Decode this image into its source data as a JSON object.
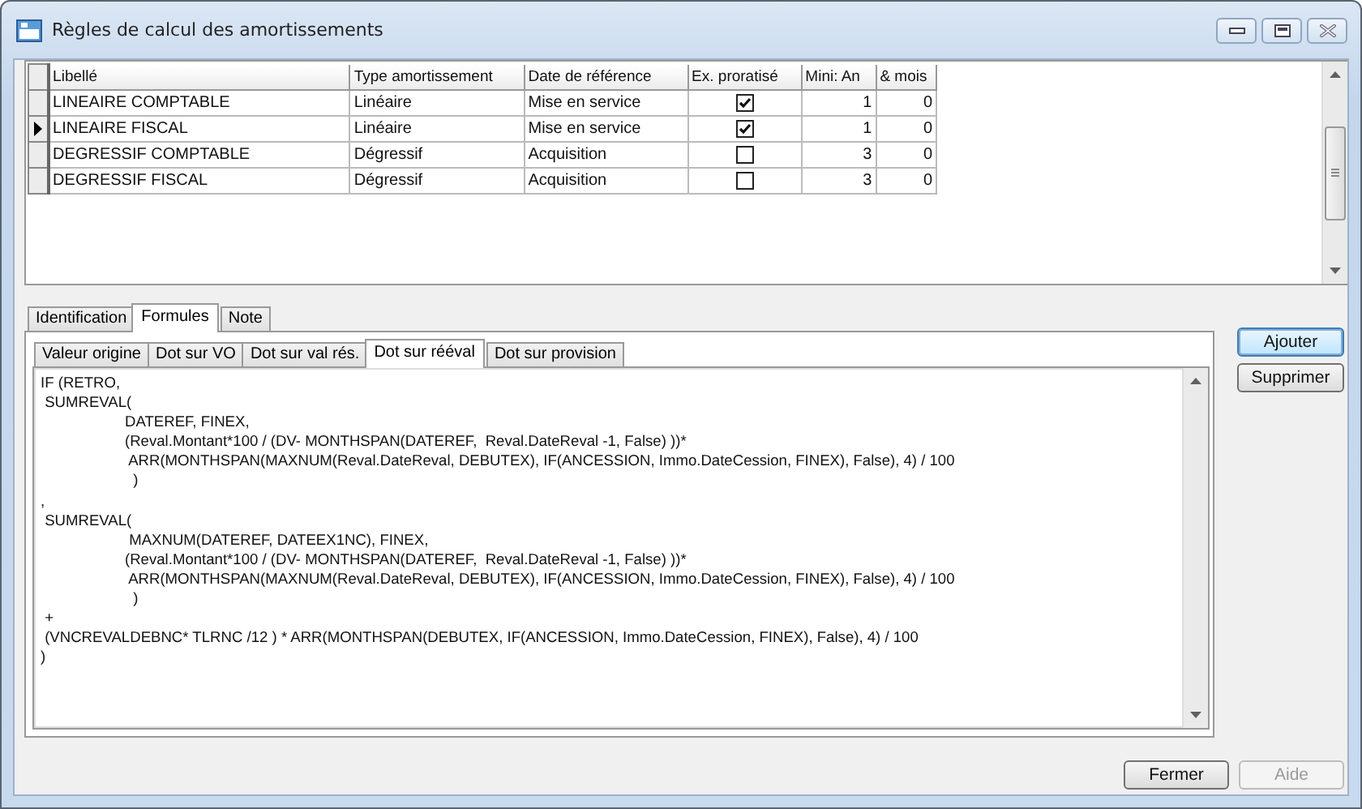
{
  "window": {
    "title": "Règles de calcul des amortissements"
  },
  "grid": {
    "columns": [
      "Libellé",
      "Type amortissement",
      "Date de référence",
      "Ex. proratisé",
      "Mini: An",
      "& mois"
    ],
    "rows": [
      {
        "label": "LINEAIRE COMPTABLE",
        "type": "Linéaire",
        "reference_date": "Mise en service",
        "prorata": true,
        "min_years": "1",
        "months": "0",
        "selected": false
      },
      {
        "label": "LINEAIRE FISCAL",
        "type": "Linéaire",
        "reference_date": "Mise en service",
        "prorata": true,
        "min_years": "1",
        "months": "0",
        "selected": true
      },
      {
        "label": "DEGRESSIF COMPTABLE",
        "type": "Dégressif",
        "reference_date": "Acquisition",
        "prorata": false,
        "min_years": "3",
        "months": "0",
        "selected": false
      },
      {
        "label": "DEGRESSIF FISCAL",
        "type": "Dégressif",
        "reference_date": "Acquisition",
        "prorata": false,
        "min_years": "3",
        "months": "0",
        "selected": false
      }
    ]
  },
  "tabs": [
    {
      "label": "Identification",
      "selected": false
    },
    {
      "label": "Formules",
      "selected": true
    },
    {
      "label": "Note",
      "selected": false
    }
  ],
  "formula_tabs": [
    {
      "label": "Valeur origine",
      "selected": false
    },
    {
      "label": "Dot sur VO",
      "selected": false
    },
    {
      "label": "Dot sur val rés.",
      "selected": false
    },
    {
      "label": "Dot sur rééval",
      "selected": true
    },
    {
      "label": "Dot sur provision",
      "selected": false
    }
  ],
  "formula": {
    "lines": [
      "IF (RETRO,",
      " SUMREVAL(",
      "\tDATEREF, FINEX,",
      "\t(Reval.Montant*100 / (DV- MONTHSPAN(DATEREF,  Reval.DateReval -1, False) ))*",
      "\t ARR(MONTHSPAN(MAXNUM(Reval.DateReval, DEBUTEX), IF(ANCESSION, Immo.DateCession, FINEX), False), 4) / 100",
      "\t  )",
      ",",
      " SUMREVAL(",
      "\t MAXNUM(DATEREF, DATEEX1NC), FINEX,",
      "\t(Reval.Montant*100 / (DV- MONTHSPAN(DATEREF,  Reval.DateReval -1, False) ))*",
      "\t ARR(MONTHSPAN(MAXNUM(Reval.DateReval, DEBUTEX), IF(ANCESSION, Immo.DateCession, FINEX), False), 4) / 100",
      "\t  )",
      " +",
      " (VNCREVALDEBNC* TLRNC /12 ) * ARR(MONTHSPAN(DEBUTEX, IF(ANCESSION, Immo.DateCession, FINEX), False), 4) / 100",
      ")"
    ]
  },
  "side_buttons": [
    {
      "label": "Ajouter",
      "default": true
    },
    {
      "label": "Supprimer",
      "default": false
    }
  ],
  "footer_buttons": [
    {
      "label": "Fermer",
      "disabled": false
    },
    {
      "label": "Aide",
      "disabled": true
    }
  ]
}
